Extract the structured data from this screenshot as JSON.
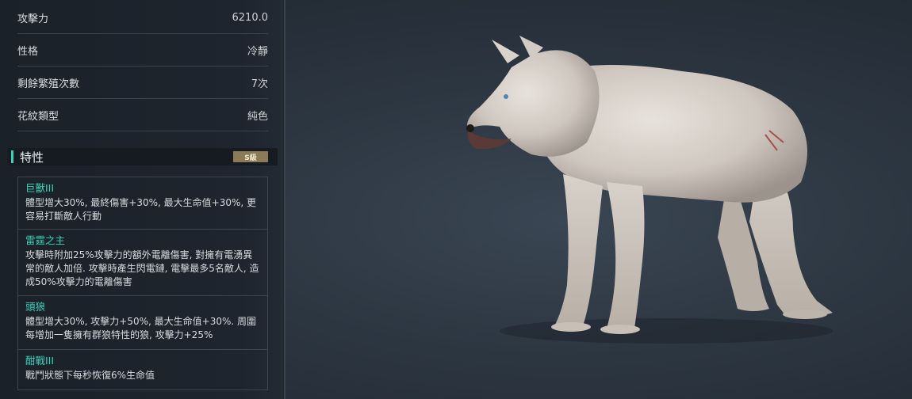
{
  "stats": [
    {
      "label": "攻擊力",
      "value": "6210.0"
    },
    {
      "label": "性格",
      "value": "冷靜"
    },
    {
      "label": "剩餘繁殖次數",
      "value": "7次"
    },
    {
      "label": "花紋類型",
      "value": "純色"
    }
  ],
  "traits": {
    "title": "特性",
    "grade": "S級",
    "items": [
      {
        "name": "巨獸III",
        "desc": "體型增大30%, 最終傷害+30%, 最大生命值+30%, 更容易打斷敵人行動"
      },
      {
        "name": "雷霆之主",
        "desc": "攻擊時附加25%攻擊力的額外電離傷害, 對擁有電湧異常的敵人加倍. 攻擊時產生閃電鏈, 電擊最多5名敵人, 造成50%攻擊力的電離傷害"
      },
      {
        "name": "頭狼",
        "desc": "體型增大30%, 攻擊力+50%, 最大生命值+30%. 周圍每增加一隻擁有群狼特性的狼, 攻擊力+25%"
      },
      {
        "name": "酣戰III",
        "desc": "戰鬥狀態下每秒恢復6%生命值"
      }
    ]
  },
  "colors": {
    "accent": "#3fd1b9",
    "grade_badge": "#8a7a55",
    "background": "#2c3641"
  },
  "icons": {
    "creature": "white-wolf-model"
  }
}
